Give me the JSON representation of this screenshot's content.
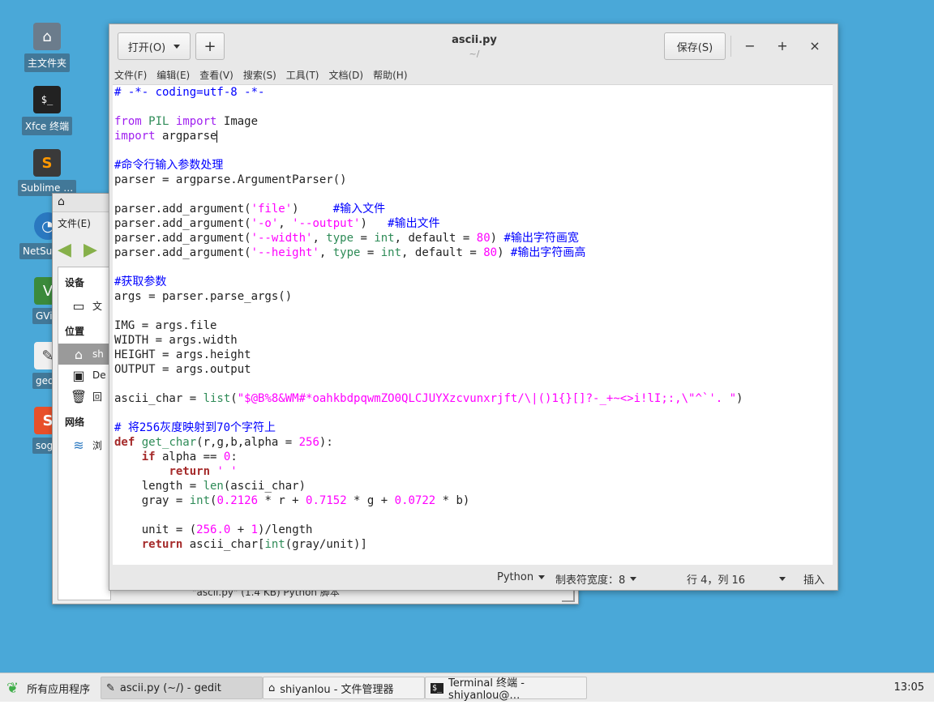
{
  "desktop_icons": [
    {
      "label": "主文件夹",
      "icon": "home-folder-icon"
    },
    {
      "label": "Xfce 终端",
      "icon": "terminal-icon"
    },
    {
      "label": "Sublime …",
      "icon": "sublime-icon"
    },
    {
      "label": "NetSu",
      "icon": "netsurf-icon"
    },
    {
      "label": "GVi",
      "icon": "gvim-icon"
    },
    {
      "label": "ged",
      "icon": "gedit-icon"
    },
    {
      "label": "sog",
      "icon": "sogou-icon"
    }
  ],
  "file_manager": {
    "menu_file": "文件(E)",
    "sidebar_devices": "设备",
    "device_fs": "文",
    "sidebar_places": "位置",
    "place_home": "sh",
    "place_desktop": "De",
    "place_trash": "回",
    "sidebar_network": "网络",
    "network_browse": "浏",
    "status": "\"ascii.py\" (1.4 KB) Python 脚本"
  },
  "gedit": {
    "open_label": "打开(O)",
    "new_tab": "+",
    "title": "ascii.py",
    "subtitle": "~/",
    "save_label": "保存(S)",
    "min": "−",
    "max": "+",
    "close": "×",
    "menu": [
      "文件(F)",
      "编辑(E)",
      "查看(V)",
      "搜索(S)",
      "工具(T)",
      "文档(D)",
      "帮助(H)"
    ],
    "status": {
      "language": "Python",
      "tab_width": "制表符宽度：8",
      "position": "行 4，列 16",
      "mode": "插入"
    }
  },
  "code_lines": [
    "# -*- coding=utf-8 -*-",
    "",
    "from PIL import Image",
    "import argparse",
    "",
    "#命令行输入参数处理",
    "parser = argparse.ArgumentParser()",
    "",
    "parser.add_argument('file')     #输入文件",
    "parser.add_argument('-o', '--output')   #输出文件",
    "parser.add_argument('--width', type = int, default = 80) #输出字符画宽",
    "parser.add_argument('--height', type = int, default = 80) #输出字符画高",
    "",
    "#获取参数",
    "args = parser.parse_args()",
    "",
    "IMG = args.file",
    "WIDTH = args.width",
    "HEIGHT = args.height",
    "OUTPUT = args.output",
    "",
    "ascii_char = list(\"$@B%8&WM#*oahkbdpqwmZO0QLCJUYXzcvunxrjft/\\|()1{}[]?-_+~<>i!lI;:,\\\"^`'. \")",
    "",
    "# 将256灰度映射到70个字符上",
    "def get_char(r,g,b,alpha = 256):",
    "    if alpha == 0:",
    "        return ' '",
    "    length = len(ascii_char)",
    "    gray = int(0.2126 * r + 0.7152 * g + 0.0722 * b)",
    "",
    "    unit = (256.0 + 1)/length",
    "    return ascii_char[int(gray/unit)]"
  ],
  "taskbar": {
    "apps_label": "所有应用程序",
    "task1": "ascii.py (~/) - gedit",
    "task2": "shiyanlou - 文件管理器",
    "task3": "Terminal 终端 - shiyanlou@…",
    "clock": "13:05"
  }
}
